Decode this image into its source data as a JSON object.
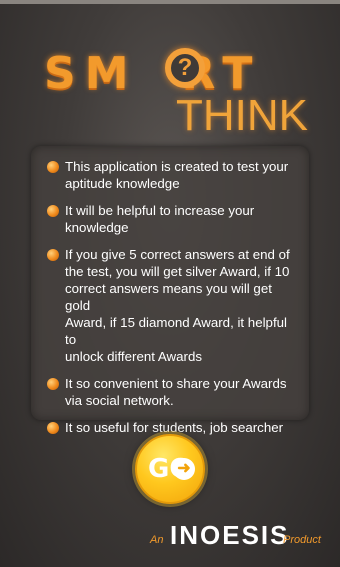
{
  "logo": {
    "smart_left": "SM",
    "smart_q": "?",
    "smart_right": "RT",
    "think": "THINK"
  },
  "info": {
    "items": [
      {
        "lines": [
          "This application is created to test your",
          "aptitude knowledge"
        ]
      },
      {
        "lines": [
          "It will be helpful to increase your",
          "knowledge"
        ]
      },
      {
        "lines": [
          "If you give 5 correct answers at end of",
          "the test, you will get silver Award, if 10",
          "correct answers means you will get gold",
          "Award, if 15 diamond Award, it helpful to",
          "unlock different Awards"
        ]
      },
      {
        "lines": [
          "It so convenient to share your Awards",
          "via social network."
        ]
      },
      {
        "lines": [
          "It so useful for students, job searcher"
        ]
      }
    ]
  },
  "go_button": {
    "label": "GO",
    "icon": "arrow-right-circle-icon"
  },
  "footer": {
    "prefix": "An",
    "brand": "INOESIS",
    "suffix": "Product"
  },
  "colors": {
    "accent": "#f29a2c",
    "go": "#ffc81e"
  }
}
